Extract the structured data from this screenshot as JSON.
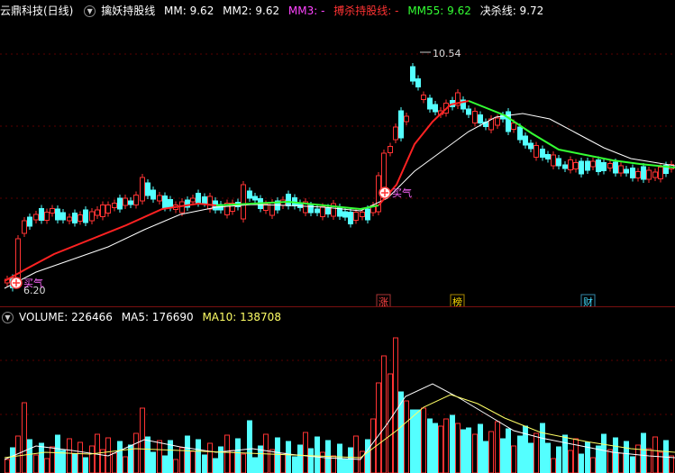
{
  "main_header": {
    "stock": "云鼎科技(日线)",
    "indicator": "擒妖持股线",
    "items": [
      {
        "label": "MM: 9.62",
        "color": "#ffffff"
      },
      {
        "label": "MM2: 9.62",
        "color": "#ffffff"
      },
      {
        "label": "MM3: -",
        "color": "#ff44ff"
      },
      {
        "label": "搏杀持股线: -",
        "color": "#ff3333"
      },
      {
        "label": "MM55: 9.62",
        "color": "#33ff33"
      },
      {
        "label": "决杀线: 9.72",
        "color": "#ffffff"
      }
    ]
  },
  "price_labels": {
    "high": "10.54",
    "low": "6.20",
    "signal": "买气"
  },
  "markers": [
    {
      "text": "涨",
      "color": "#ff4444"
    },
    {
      "text": "榜",
      "color": "#ffdd00"
    },
    {
      "text": "财",
      "color": "#44ddff"
    }
  ],
  "volume_header": {
    "items": [
      {
        "label": "VOLUME: 226466",
        "color": "#ffffff"
      },
      {
        "label": "MA5: 176690",
        "color": "#ffffff"
      },
      {
        "label": "MA10: 138708",
        "color": "#ffff66"
      }
    ]
  },
  "colors": {
    "up": "#ff3333",
    "down": "#54ffff",
    "ma_white": "#ffffff",
    "ma_green": "#33ff33",
    "ma_red": "#ff2222",
    "ma_yellow": "#ffff66"
  }
}
